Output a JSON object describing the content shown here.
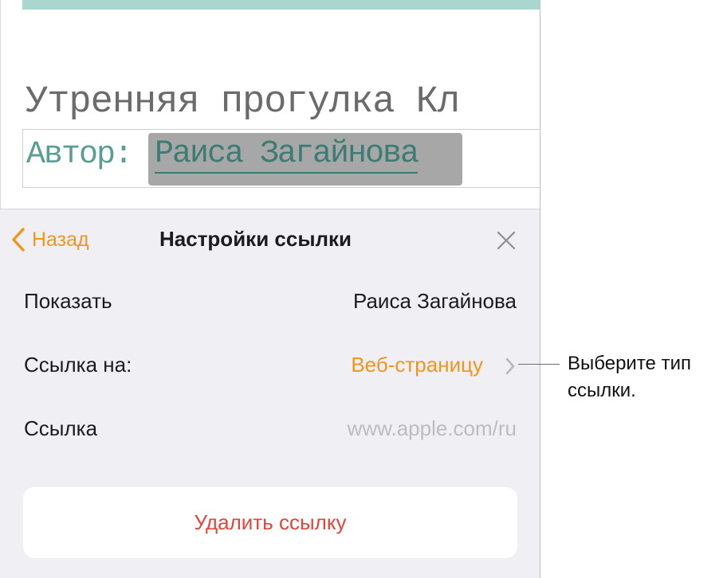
{
  "document": {
    "title": "Утренняя прогулка Кл",
    "author_label": "Автор:",
    "author_name": "Раиса Загайнова"
  },
  "panel": {
    "back_label": "Назад",
    "title": "Настройки ссылки",
    "rows": [
      {
        "label": "Показать",
        "value": "Раиса Загайнова"
      },
      {
        "label": "Ссылка на:",
        "value": "Веб-страницу"
      },
      {
        "label": "Ссылка",
        "value": "www.apple.com/ru"
      }
    ],
    "delete_label": "Удалить ссылку"
  },
  "callout": {
    "text": "Выберите тип ссылки."
  },
  "colors": {
    "accent": "#f0951f",
    "destructive": "#e5443a",
    "doc_accent": "#5a9e93",
    "panel_bg": "#efeff4"
  }
}
